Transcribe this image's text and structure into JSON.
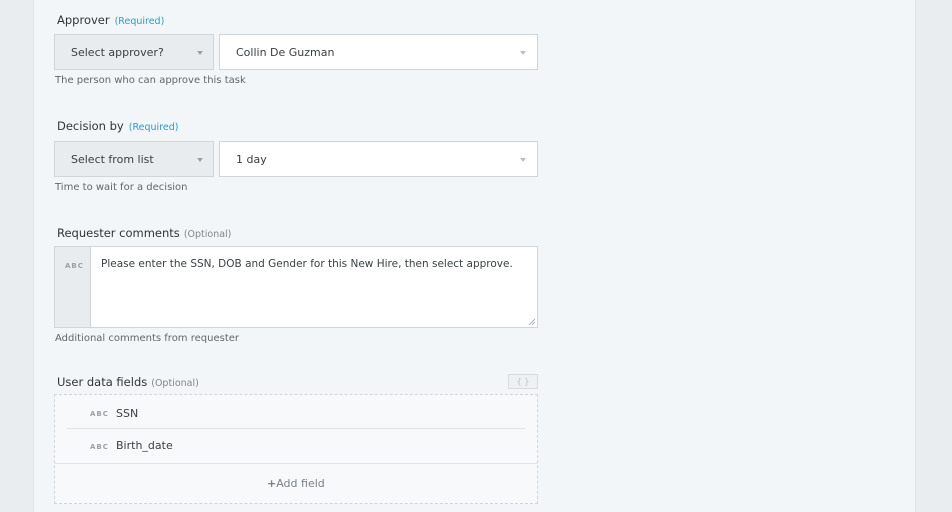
{
  "approver": {
    "label": "Approver",
    "required_tag": "(Required)",
    "mode_select": "Select approver?",
    "value": "Collin De Guzman",
    "hint": "The person who can approve this task"
  },
  "decision_by": {
    "label": "Decision by",
    "required_tag": "(Required)",
    "mode_select": "Select from list",
    "value": "1 day",
    "hint": "Time to wait for a decision"
  },
  "requester_comments": {
    "label": "Requester comments",
    "optional_tag": "(Optional)",
    "type_tag": "ABC",
    "value": "Please enter the SSN, DOB and Gender for this New Hire, then select approve.",
    "hint": "Additional comments from requester"
  },
  "user_data_fields": {
    "label": "User data fields",
    "optional_tag": "(Optional)",
    "formula_icon": "{ }",
    "fields": [
      {
        "type_tag": "ABC",
        "name": "SSN"
      },
      {
        "type_tag": "ABC",
        "name": "Birth_date"
      }
    ],
    "add_label": "Add field"
  }
}
